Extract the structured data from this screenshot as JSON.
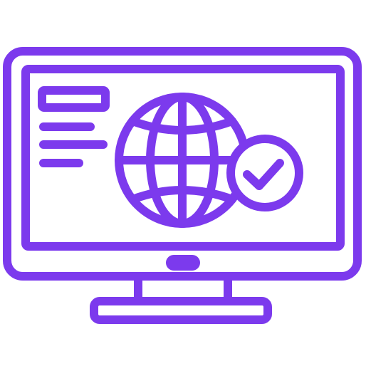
{
  "icon": {
    "name": "monitor-globe-check-icon",
    "stroke_color": "#7c3aed",
    "background_color": "#ffffff"
  }
}
